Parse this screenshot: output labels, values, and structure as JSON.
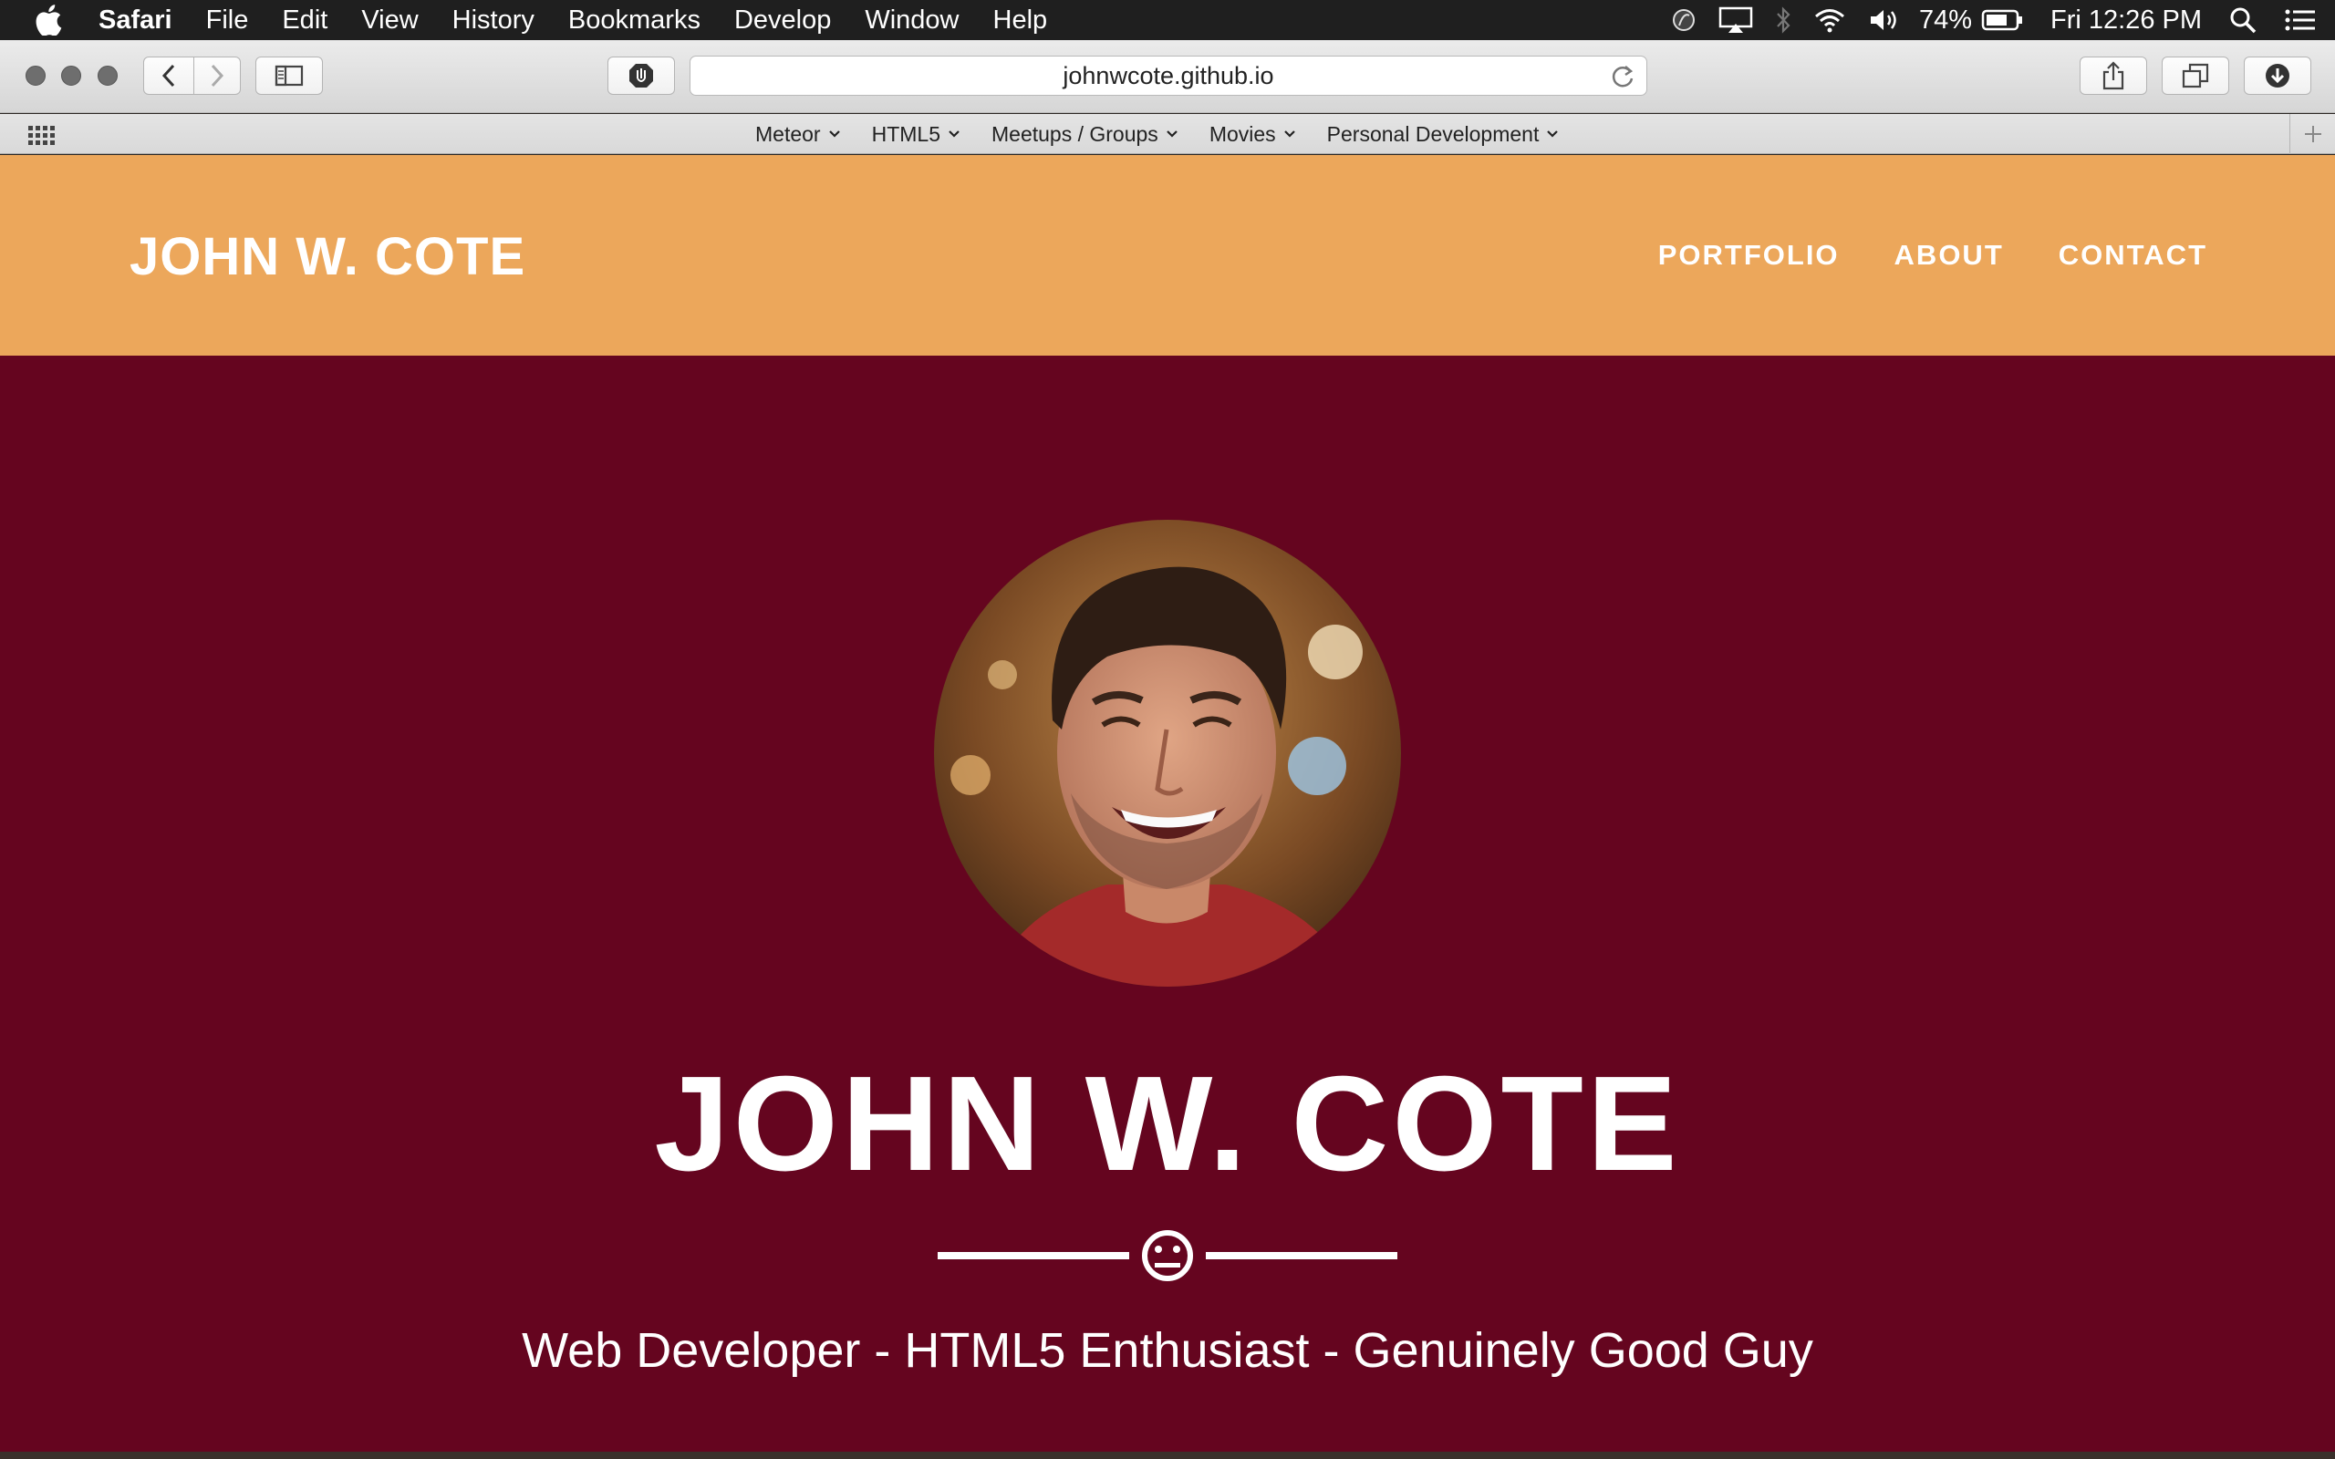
{
  "menubar": {
    "app_name": "Safari",
    "items": [
      "File",
      "Edit",
      "View",
      "History",
      "Bookmarks",
      "Develop",
      "Window",
      "Help"
    ],
    "battery": "74%",
    "clock": "Fri 12:26 PM",
    "icons": [
      "apple-icon",
      "circle-app-icon",
      "airplay-icon",
      "bluetooth-icon",
      "wifi-icon",
      "volume-icon",
      "battery-icon",
      "spotlight-icon",
      "notification-center-icon"
    ]
  },
  "toolbar": {
    "url": "johnwcote.github.io",
    "icons": [
      "back-icon",
      "forward-icon",
      "sidebar-icon",
      "privacy-shield-icon",
      "reload-icon",
      "share-icon",
      "tabs-icon",
      "downloads-icon"
    ]
  },
  "favorites": {
    "items": [
      {
        "label": "Meteor"
      },
      {
        "label": "HTML5"
      },
      {
        "label": "Meetups / Groups"
      },
      {
        "label": "Movies"
      },
      {
        "label": "Personal Development"
      }
    ]
  },
  "site": {
    "brand": "JOHN W. COTE",
    "nav": [
      {
        "label": "PORTFOLIO"
      },
      {
        "label": "ABOUT"
      },
      {
        "label": "CONTACT"
      }
    ],
    "hero_title": "JOHN W. COTE",
    "tagline": "Web Developer - HTML5 Enthusiast - Genuinely Good Guy",
    "divider_icon": "neutral-face-icon"
  },
  "colors": {
    "header_bg": "#eca75b",
    "hero_bg": "#65051f",
    "text": "#ffffff"
  }
}
